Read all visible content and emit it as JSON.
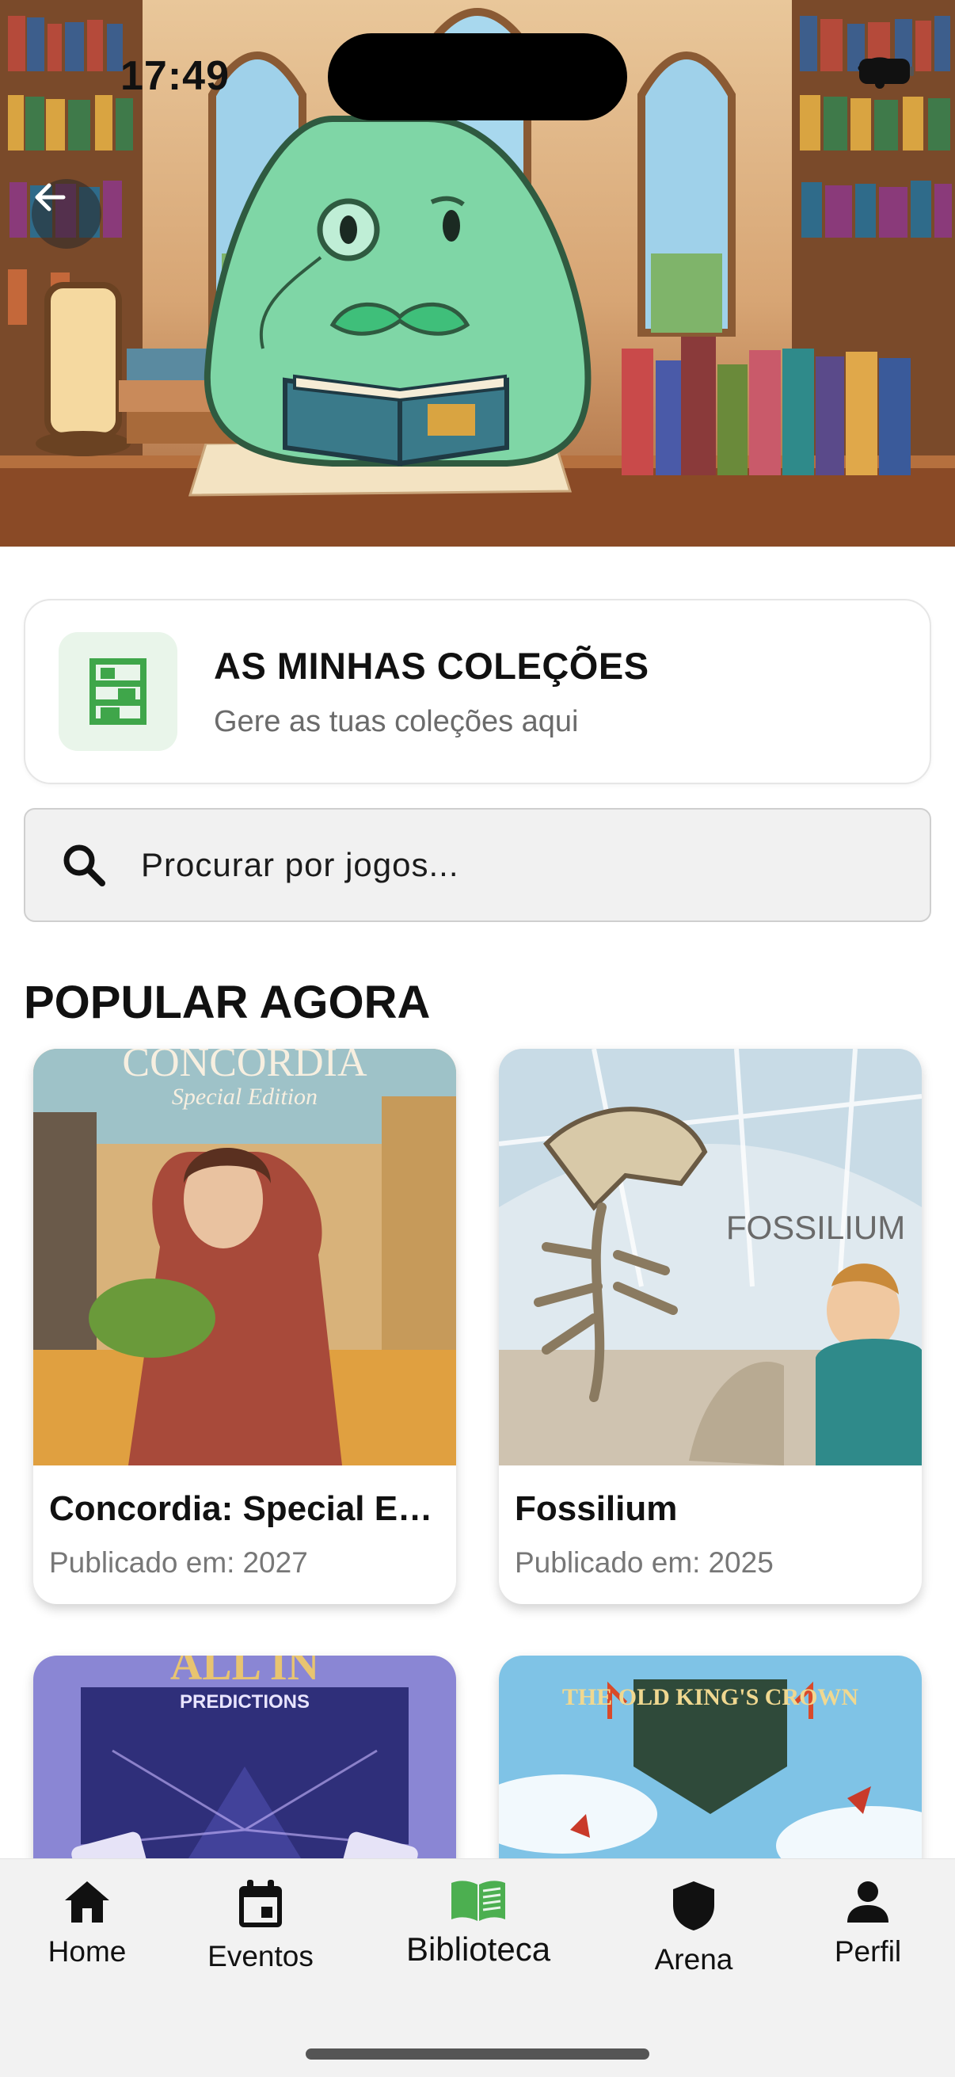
{
  "status_bar": {
    "time": "17:49"
  },
  "collections": {
    "title": "AS MINHAS COLEÇÕES",
    "subtitle": "Gere as tuas coleções aqui"
  },
  "search": {
    "placeholder": "Procurar por jogos..."
  },
  "popular": {
    "title": "POPULAR AGORA",
    "published_label": "Publicado em:",
    "games": [
      {
        "title": "Concordia: Special Edi...",
        "year": "2027",
        "cover_text": "CONCORDIA",
        "cover_subtext": "Special Edition"
      },
      {
        "title": "Fossilium",
        "year": "2025",
        "cover_text": "FOSSILIUM"
      },
      {
        "title": "",
        "year": "",
        "cover_text": "ALL IN",
        "cover_subtext": "PREDICTIONS"
      },
      {
        "title": "",
        "year": "",
        "cover_text": "THE OLD KING'S CROWN"
      }
    ]
  },
  "bottom_nav": {
    "items": [
      {
        "label": "Home",
        "icon": "home-icon"
      },
      {
        "label": "Eventos",
        "icon": "calendar-icon"
      },
      {
        "label": "Biblioteca",
        "icon": "book-icon",
        "active": true
      },
      {
        "label": "Arena",
        "icon": "shield-icon"
      },
      {
        "label": "Perfil",
        "icon": "person-icon"
      }
    ]
  },
  "colors": {
    "accent_green": "#4caf50",
    "icon_bg": "#e9f5ea",
    "mascot": "#7fd6a6"
  }
}
